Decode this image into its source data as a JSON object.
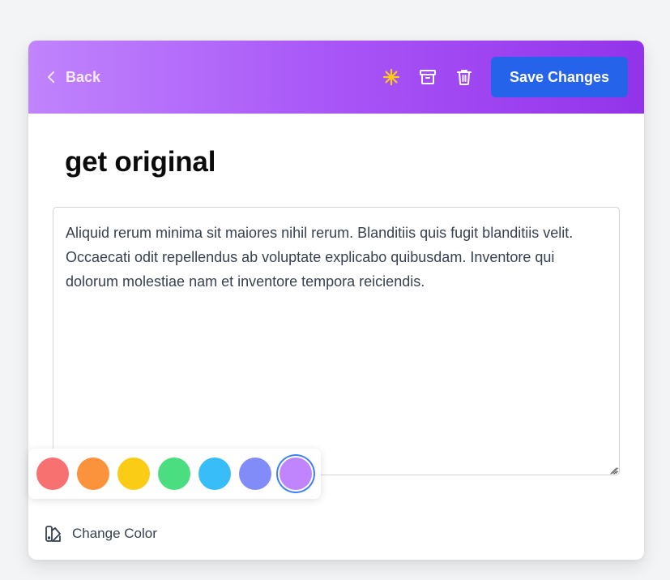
{
  "header": {
    "back_label": "Back",
    "save_label": "Save Changes",
    "icons": [
      "asterisk-icon",
      "archive-icon",
      "trash-icon"
    ]
  },
  "note": {
    "title": "get original",
    "body": "Aliquid rerum minima sit maiores nihil rerum. Blanditiis quis fugit blanditiis velit. Occaecati odit repellendus ab voluptate explicabo quibusdam. Inventore qui dolorum molestiae nam et inventore tempora reiciendis."
  },
  "palette": {
    "colors": [
      "#f87171",
      "#fb923c",
      "#facc15",
      "#4ade80",
      "#38bdf8",
      "#818cf8",
      "#c084fc"
    ],
    "selected": "#c084fc"
  },
  "footer": {
    "change_color_label": "Change Color"
  },
  "theme": {
    "accent": "#2563eb",
    "header_gradient": [
      "#c084fc",
      "#9333ea"
    ]
  }
}
